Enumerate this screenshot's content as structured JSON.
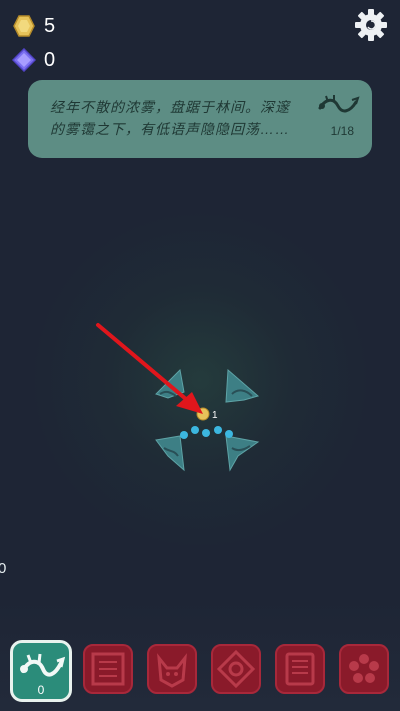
{
  "hud": {
    "coin_count": "5",
    "gem_count": "0",
    "left_edge_value": "0"
  },
  "story": {
    "text_line1": "经年不散的浓雾，盘踞于林间。深邃",
    "text_line2": "的雾霭之下，有低语声隐隐回荡……",
    "progress": "1/18"
  },
  "scene": {
    "node_coin_count": "1"
  },
  "toolbar": {
    "active_count": "0",
    "slots": [
      "dragon",
      "locked",
      "locked",
      "locked",
      "locked",
      "locked"
    ]
  },
  "colors": {
    "accent": "#2b8c7a",
    "locked": "#8a1a2a",
    "arrow": "#e0161c",
    "dots": "#3cb7e0"
  }
}
